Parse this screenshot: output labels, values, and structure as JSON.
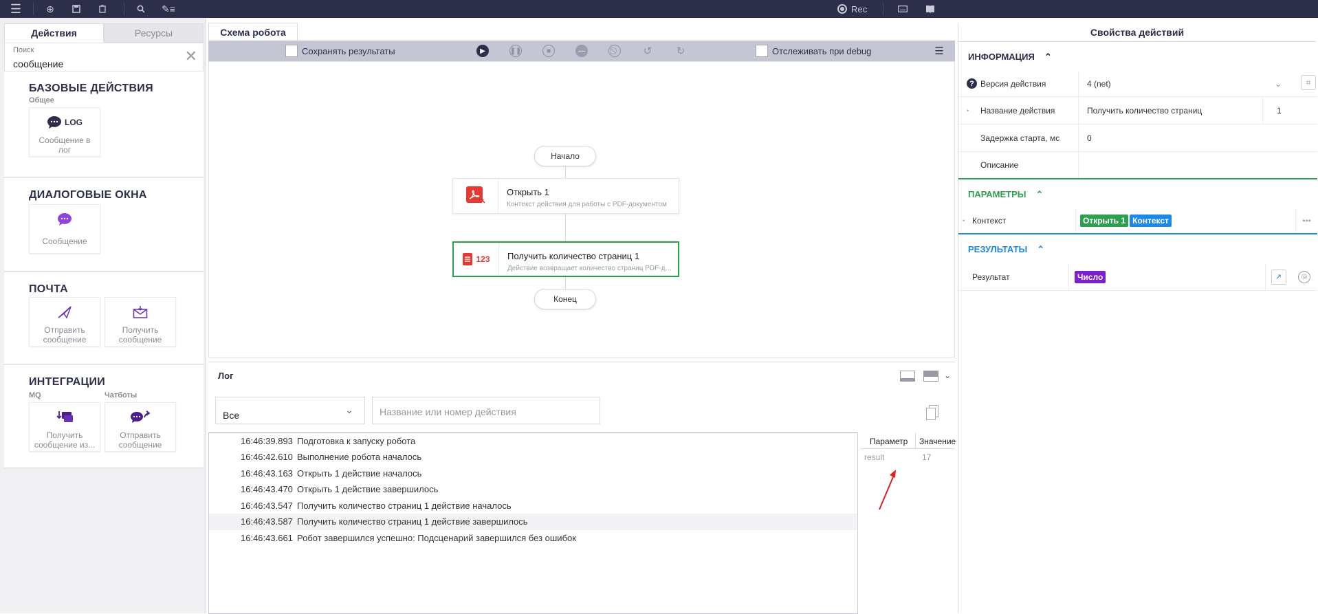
{
  "colors": {
    "topbar": "#2d2f4a",
    "accent_green": "#2e9e4f",
    "accent_blue": "#1e88e5",
    "tag_purple": "#7b1fd0",
    "pdf_red": "#e53935"
  },
  "topbar": {
    "icons": [
      "menu-icon",
      "add-icon",
      "save-icon",
      "clipboard-icon",
      "search-icon",
      "edit-list-icon",
      "record-icon",
      "keyboard-icon",
      "book-icon"
    ],
    "rec_label": "Rec"
  },
  "left": {
    "tabs": [
      "Действия",
      "Ресурсы"
    ],
    "search": {
      "label": "Поиск",
      "value": "сообщение"
    },
    "sections": [
      {
        "title": "БАЗОВЫЕ ДЕЙСТВИЯ",
        "subtitle": "Общее",
        "cards": [
          {
            "icon": "chat-icon",
            "badge": "LOG",
            "label": "Сообщение в лог"
          }
        ]
      },
      {
        "title": "ДИАЛОГОВЫЕ ОКНА",
        "cards": [
          {
            "icon": "message-bubble-icon",
            "label": "Сообщение"
          }
        ]
      },
      {
        "title": "ПОЧТА",
        "cards": [
          {
            "icon": "send-icon",
            "label": "Отправить сообщение"
          },
          {
            "icon": "envelope-icon",
            "label": "Получить сообщение"
          }
        ]
      },
      {
        "title": "ИНТЕГРАЦИИ",
        "subtitles": [
          "MQ",
          "Чатботы"
        ],
        "cards": [
          {
            "icon": "receive-queue-icon",
            "label": "Получить сообщение из..."
          },
          {
            "icon": "chat-send-icon",
            "label": "Отправить сообщение"
          }
        ]
      }
    ]
  },
  "center": {
    "tab": "Схема робота",
    "toolbar": {
      "save_results": "Сохранять результаты",
      "track_debug": "Отслеживать при debug"
    },
    "flow": {
      "start": "Начало",
      "end": "Конец",
      "nodes": [
        {
          "title": "Открыть  1",
          "desc": "Контекст действия для работы с PDF-документом",
          "icon": "pdf-icon"
        },
        {
          "title": "Получить количество страниц  1",
          "desc": "Действие возвращает количество страниц PDF-документа",
          "icon": "page-count-icon",
          "icon_text": "123"
        }
      ]
    }
  },
  "log": {
    "title": "Лог",
    "filter_select": "Все",
    "filter_placeholder": "Название или номер действия",
    "rows": [
      {
        "time": "16:46:39.893",
        "msg": "Подготовка к запуску робота"
      },
      {
        "time": "16:46:42.610",
        "msg": "Выполнение робота началось"
      },
      {
        "time": "16:46:43.163",
        "msg": "Открыть 1 действие началось"
      },
      {
        "time": "16:46:43.470",
        "msg": "Открыть 1 действие завершилось"
      },
      {
        "time": "16:46:43.547",
        "msg": "Получить количество страниц 1 действие началось"
      },
      {
        "time": "16:46:43.587",
        "msg": "Получить количество страниц 1 действие завершилось"
      },
      {
        "time": "16:46:43.661",
        "msg": "Робот завершился успешно: Подсценарий завершился без ошибок"
      }
    ],
    "params": {
      "header_param": "Параметр",
      "header_value": "Значение",
      "param": "result",
      "value": "17"
    }
  },
  "right": {
    "title": "Свойства действий",
    "info": {
      "title": "ИНФОРМАЦИЯ",
      "version_label": "Версия действия",
      "version_value": "4 (net)",
      "name_label": "Название действия",
      "name_value": "Получить количество страниц",
      "name_number": "1",
      "delay_label": "Задержка старта, мс",
      "delay_value": "0",
      "desc_label": "Описание"
    },
    "params": {
      "title": "ПАРАМЕТРЫ",
      "context_label": "Контекст",
      "tag1": "Открыть 1",
      "tag2": "Контекст"
    },
    "results": {
      "title": "РЕЗУЛЬТАТЫ",
      "result_label": "Результат",
      "tag": "Число"
    }
  }
}
